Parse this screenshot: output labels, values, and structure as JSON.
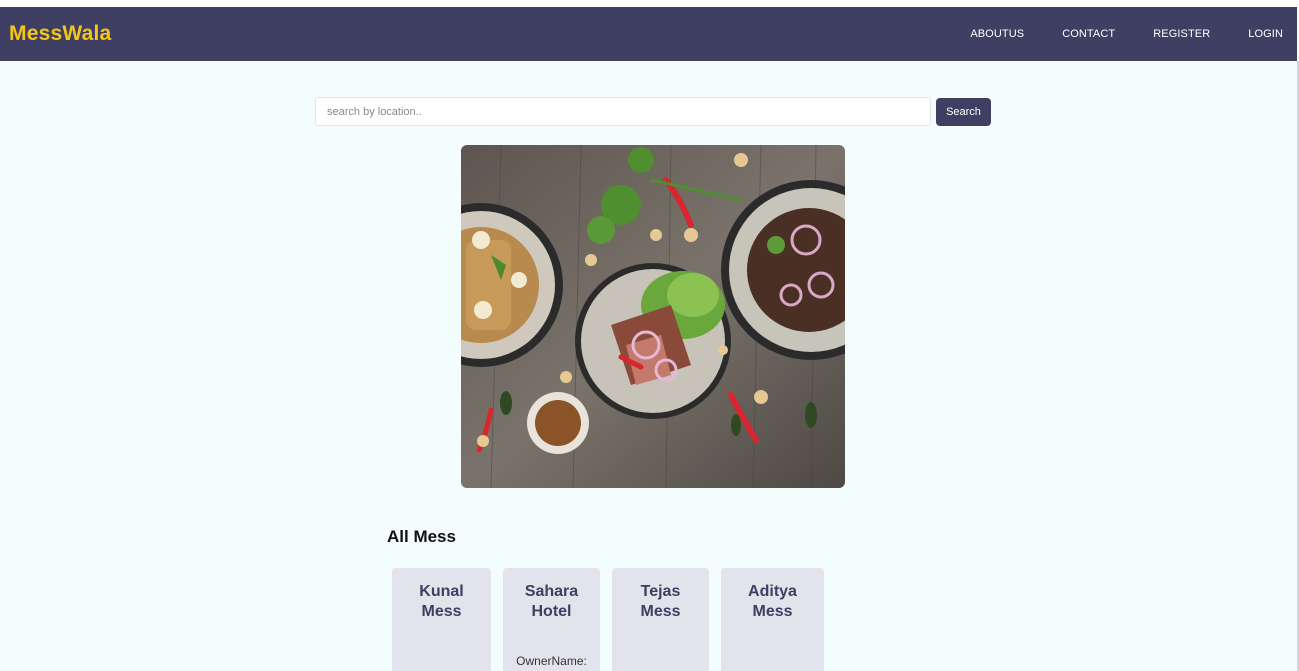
{
  "brand": {
    "name": "MessWala"
  },
  "nav": {
    "items": [
      {
        "label": "ABOUTUS"
      },
      {
        "label": "CONTACT"
      },
      {
        "label": "REGISTER"
      },
      {
        "label": "LOGIN"
      }
    ]
  },
  "search": {
    "placeholder": "search by location..",
    "value": "",
    "button_label": "Search"
  },
  "hero": {
    "image": "food-bowls-photo"
  },
  "section": {
    "title": "All Mess"
  },
  "cards": [
    {
      "title": "Kunal Mess",
      "owner_label": ""
    },
    {
      "title": "Sahara Hotel",
      "owner_label": "OwnerName:"
    },
    {
      "title": "Tejas Mess",
      "owner_label": ""
    },
    {
      "title": "Aditya Mess",
      "owner_label": ""
    }
  ],
  "colors": {
    "navbar": "#3f3f63",
    "brand": "#f5c518",
    "page_background": "#f4fdfd",
    "card_background": "#e3e3ec",
    "button": "#3f3f63"
  }
}
